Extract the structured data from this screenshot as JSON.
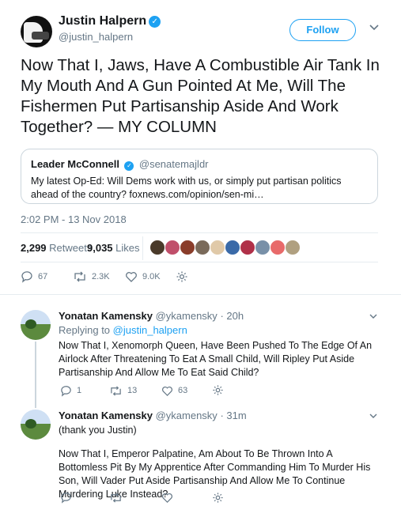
{
  "author": {
    "display_name": "Justin Halpern",
    "handle": "@justin_halpern",
    "follow_label": "Follow",
    "verified_mark": "✓"
  },
  "tweet": {
    "text": "Now That I, Jaws, Have A Combustible Air Tank In My Mouth And A Gun Pointed At Me, Will The Fishermen Put Partisanship Aside And Work Together? — MY COLUMN",
    "timestamp": "2:02 PM - 13 Nov 2018"
  },
  "quote": {
    "name": "Leader McConnell",
    "handle": "@senatemajldr",
    "text": "My latest Op-Ed: Will Dems work with us, or simply put partisan politics ahead of the country? foxnews.com/opinion/sen-mi…"
  },
  "stats": {
    "retweets_count": "2,299",
    "retweets_label": "Retweets",
    "likes_count": "9,035",
    "likes_label": "Likes",
    "face_colors": [
      "#4a3a2a",
      "#c04f6a",
      "#8a3d2a",
      "#7a6a5a",
      "#e0c9a8",
      "#3a6aa8",
      "#b03048",
      "#7890a8",
      "#e86a6a",
      "#b0a080"
    ]
  },
  "actions": {
    "replies": "67",
    "retweets": "2.3K",
    "likes": "9.0K"
  },
  "replies": [
    {
      "name": "Yonatan Kamensky",
      "handle": "@ykamensky",
      "time": "· 20h",
      "replying_prefix": "Replying to",
      "replying_to": "@justin_halpern",
      "text": "Now That I, Xenomorph Queen, Have Been Pushed To The Edge Of An Airlock After Threatening To Eat A Small Child, Will Ripley Put Aside Partisanship And Allow Me To Eat Said Child?",
      "reply_count": "1",
      "retweet_count": "13",
      "like_count": "63"
    },
    {
      "name": "Yonatan Kamensky",
      "handle": "@ykamensky",
      "time": "· 31m",
      "text_line1": "(thank you Justin)",
      "text": "Now That I, Emperor Palpatine, Am About To Be Thrown Into A Bottomless Pit By My Apprentice After Commanding Him To Murder His Son, Will Vader Put Aside Partisanship And Allow Me To Continue Murdering Luke Instead?"
    }
  ],
  "colors": {
    "accent": "#1da1f2",
    "muted": "#657786",
    "text": "#14171a",
    "border": "#e6ecf0"
  }
}
